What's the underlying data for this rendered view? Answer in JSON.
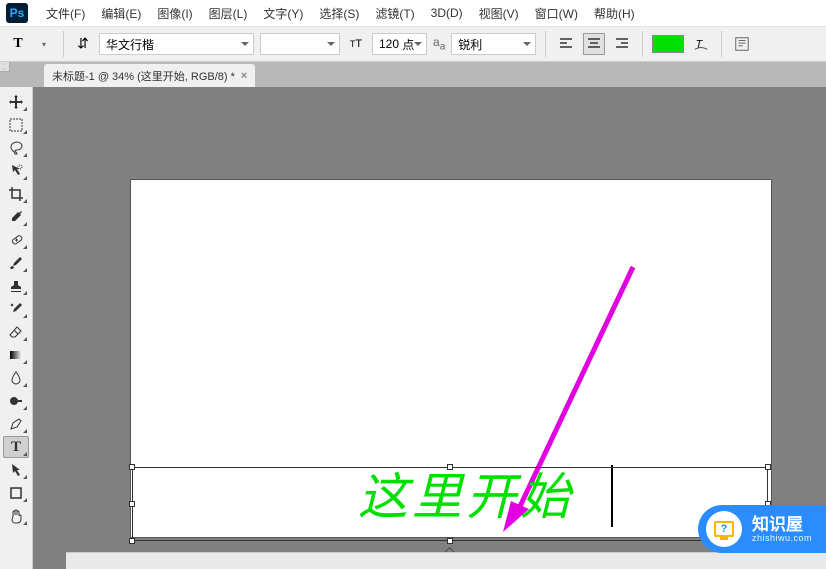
{
  "app": {
    "logo": "Ps"
  },
  "menu": [
    "文件(F)",
    "编辑(E)",
    "图像(I)",
    "图层(L)",
    "文字(Y)",
    "选择(S)",
    "滤镜(T)",
    "3D(D)",
    "视图(V)",
    "窗口(W)",
    "帮助(H)"
  ],
  "text_toolbar": {
    "font_family": "华文行楷",
    "font_style": "",
    "size_label": "点",
    "size_value": "120",
    "aa_prefix": "a_a",
    "aa_value": "锐利",
    "color": "#00e000"
  },
  "tab": {
    "title": "未标题-1 @ 34% (这里开始, RGB/8) *"
  },
  "canvas": {
    "text": "这里开始"
  },
  "watermark": {
    "title": "知识屋",
    "url": "zhishiwu.com",
    "q": "?"
  },
  "icons": {
    "move": "move",
    "marquee": "marquee",
    "lasso": "lasso",
    "wand": "wand",
    "crop": "crop",
    "eyedropper": "eyedropper",
    "heal": "heal",
    "brush": "brush",
    "stamp": "stamp",
    "history": "history",
    "eraser": "eraser",
    "gradient": "gradient",
    "blur": "blur",
    "dodge": "dodge",
    "pen": "pen",
    "type": "type",
    "path": "path",
    "shape": "shape",
    "hand": "hand"
  }
}
